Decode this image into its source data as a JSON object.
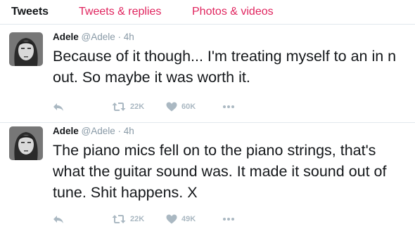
{
  "tabs": [
    {
      "label": "Tweets",
      "active": true
    },
    {
      "label": "Tweets & replies",
      "active": false
    },
    {
      "label": "Photos & videos",
      "active": false
    }
  ],
  "tweets": [
    {
      "name": "Adele",
      "handle": "@Adele",
      "separator": "·",
      "time": "4h",
      "text": "Because of it though... I'm treating myself to an in n out. So maybe it was worth it.",
      "retweets": "22K",
      "likes": "60K"
    },
    {
      "name": "Adele",
      "handle": "@Adele",
      "separator": "·",
      "time": "4h",
      "text": "The piano mics fell on to the piano strings, that's what the guitar sound was. It made it sound out of tune. Shit happens. X",
      "retweets": "22K",
      "likes": "49K"
    }
  ],
  "icons": {
    "reply": "reply-icon",
    "retweet": "retweet-icon",
    "like": "heart-icon",
    "more": "more-icon"
  },
  "colors": {
    "accent": "#e0245e",
    "action_gray": "#aab8c2",
    "meta_gray": "#8899a6",
    "divider": "#e1e8ed"
  }
}
